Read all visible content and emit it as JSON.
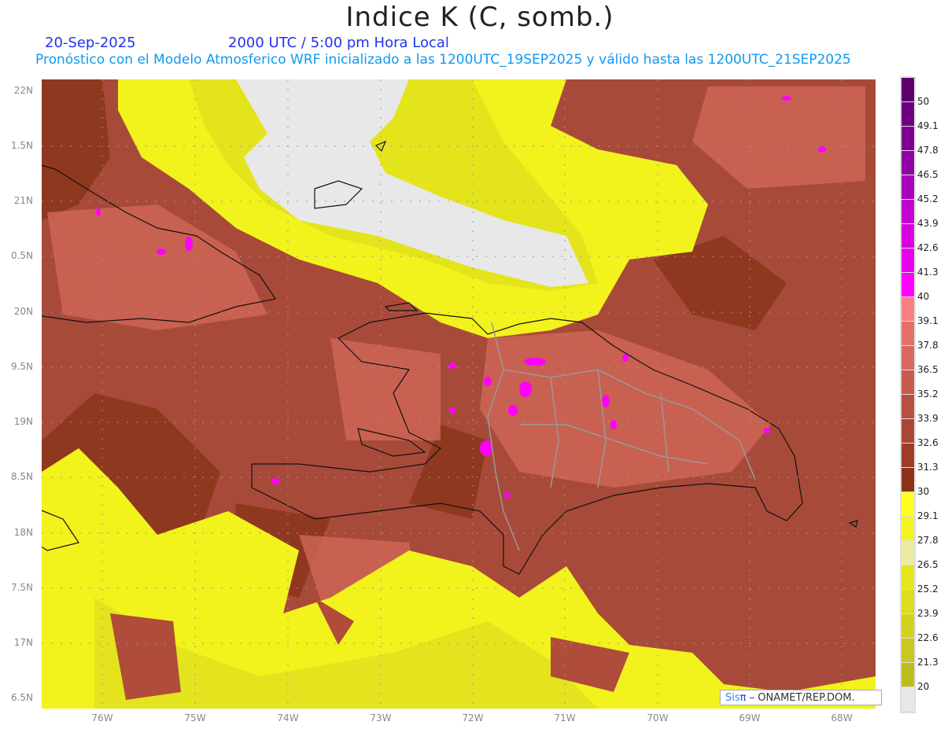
{
  "header": {
    "title": "Indice K (C, somb.)",
    "date": "20-Sep-2025",
    "time": "2000 UTC / 5:00 pm Hora Local",
    "subtitle": "Pronóstico con el Modelo Atmosferico WRF inicializado a las 1200UTC_19SEP2025 y válido hasta las  1200UTC_21SEP2025"
  },
  "axes": {
    "lat_labels": [
      "22N",
      "1.5N",
      "21N",
      "0.5N",
      "20N",
      "9.5N",
      "19N",
      "8.5N",
      "18N",
      "7.5N",
      "17N",
      "6.5N"
    ],
    "lon_labels": [
      "76W",
      "75W",
      "74W",
      "73W",
      "72W",
      "71W",
      "70W",
      "69W",
      "68W"
    ]
  },
  "colorbar": {
    "labels": [
      "50",
      "49.1",
      "47.8",
      "46.5",
      "45.2",
      "43.9",
      "42.6",
      "41.3",
      "40",
      "39.1",
      "37.8",
      "36.5",
      "35.2",
      "33.9",
      "32.6",
      "31.3",
      "30",
      "29.1",
      "27.8",
      "26.5",
      "25.2",
      "23.9",
      "22.6",
      "21.3",
      "20"
    ],
    "colors": [
      "#5e006c",
      "#6e0080",
      "#7e0090",
      "#9000a6",
      "#a600ba",
      "#c200d0",
      "#d800e0",
      "#e800ec",
      "#ff00ff",
      "#f88080",
      "#e67068",
      "#d86860",
      "#c85a4c",
      "#b85040",
      "#ac4634",
      "#9e3c28",
      "#8c3218",
      "#ffff22",
      "#f4f422",
      "#ececa0",
      "#e6e620",
      "#dcdc20",
      "#d2d21e",
      "#c8c81e",
      "#bcbc1e",
      "#e8e8e8"
    ]
  },
  "credit": {
    "sis": "Sis",
    "pi": "π",
    "rest": " –  ONAMET/REP.DOM."
  }
}
